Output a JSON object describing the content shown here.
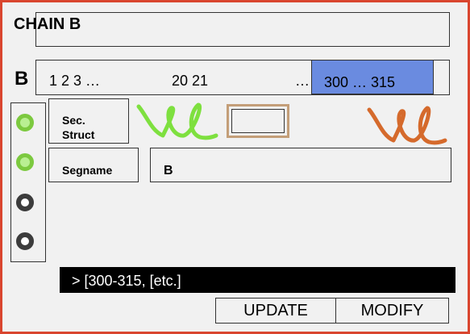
{
  "chain": {
    "title": "CHAIN B",
    "letter": "B"
  },
  "sequence": {
    "start_label": "1 2 3 …",
    "middle_label": "20 21",
    "ellipsis": "…",
    "selected_range": "300 … 315"
  },
  "radios": [
    {
      "state": "green"
    },
    {
      "state": "green"
    },
    {
      "state": "gray"
    },
    {
      "state": "gray"
    }
  ],
  "sec_struct": {
    "label_line1": "Sec.",
    "label_line2": "Struct"
  },
  "segname": {
    "label": "Segname",
    "value": "B"
  },
  "console": {
    "text": "> [300-315, [etc.]"
  },
  "buttons": {
    "update_label": "UPDATE",
    "modify_label": "MODIFY"
  },
  "colors": {
    "frame_border": "#d9462f",
    "selection_fill": "#6a8be0",
    "green_scribble": "#7ee03f",
    "orange_scribble": "#d56a2c",
    "tan_rect": "#c39e78"
  }
}
